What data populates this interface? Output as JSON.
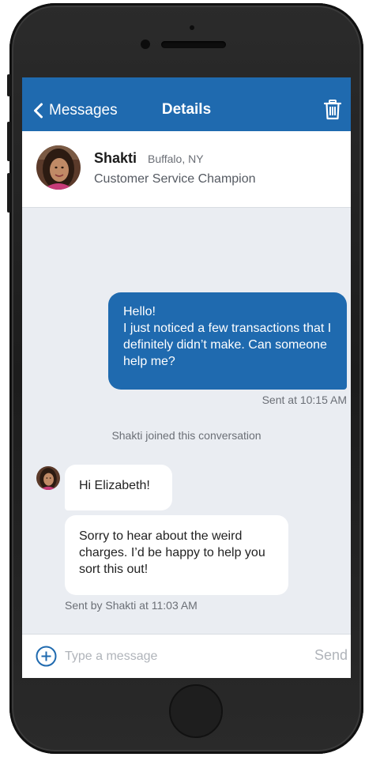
{
  "nav": {
    "back_label": "Messages",
    "title": "Details",
    "back_icon": "chevron-left-icon",
    "trash_icon": "trash-icon"
  },
  "agent": {
    "name": "Shakti",
    "location": "Buffalo, NY",
    "role": "Customer Service Champion"
  },
  "conversation": {
    "outgoing": {
      "lines": [
        "Hello!",
        "I just noticed a few transactions that I definitely didn’t make. Can someone help me?"
      ],
      "meta": "Sent at 10:15 AM"
    },
    "system": "Shakti joined this conversation",
    "incoming": [
      {
        "text": "Hi Elizabeth!"
      },
      {
        "text": "Sorry to hear about the weird charges. I’d be happy to help you sort this out!"
      }
    ],
    "incoming_meta": "Sent by Shakti at 11:03 AM"
  },
  "composer": {
    "placeholder": "Type a message",
    "send_label": "Send",
    "add_icon": "plus-circle-icon"
  },
  "colors": {
    "brand": "#1f6aaf",
    "background": "#eaedf2"
  }
}
